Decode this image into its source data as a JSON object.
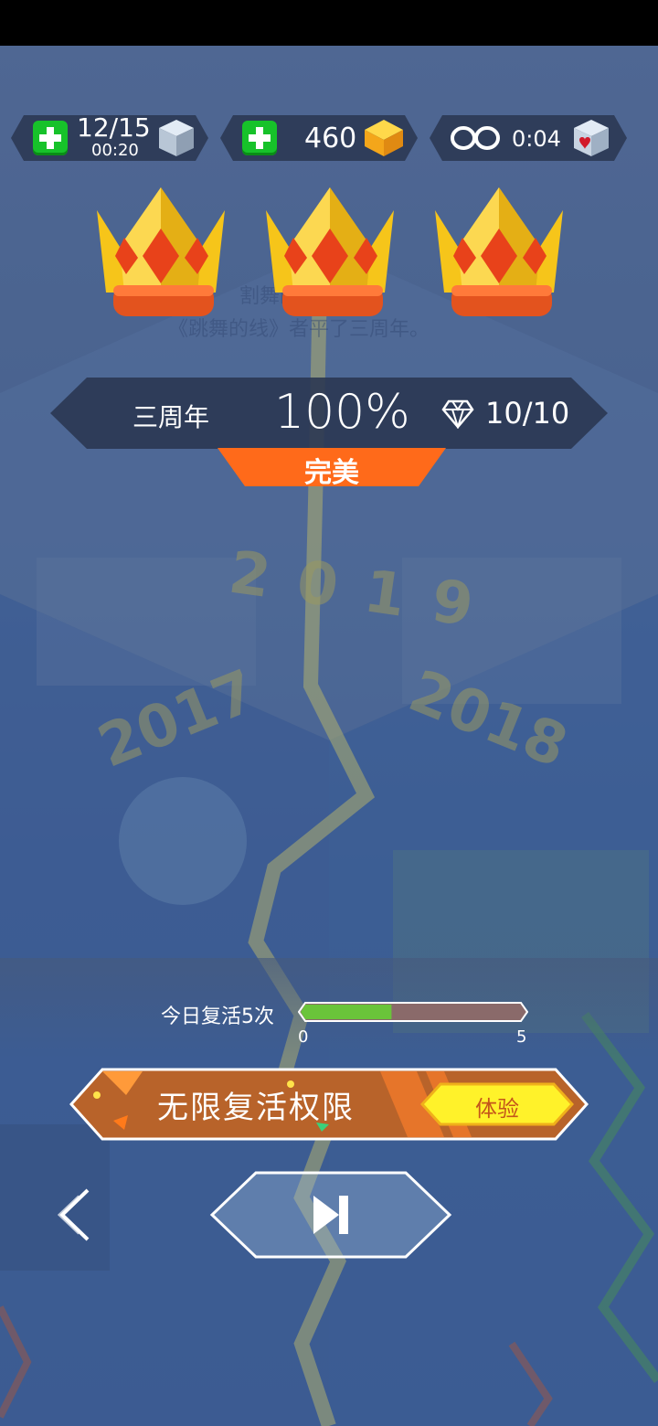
{
  "hud": {
    "lives": {
      "value": "12/15",
      "timer": "00:20"
    },
    "gems": {
      "value": "460"
    },
    "infinite": {
      "timer": "0:04"
    }
  },
  "result": {
    "crowns": 3,
    "level_name": "三周年",
    "percent": "100%",
    "diamonds": "10/10",
    "rating": "完美"
  },
  "background_text": {
    "line1": "割舞的坐世,",
    "line2": "《跳舞的线》者平了三周年。",
    "year_2019": "2019",
    "year_2017": "2017",
    "year_2018": "2018"
  },
  "revive": {
    "label": "今日复活5次",
    "min": "0",
    "max": "5",
    "progress": 0.4
  },
  "unlimited": {
    "title": "无限复活权限",
    "try_label": "体验"
  },
  "colors": {
    "accent_orange": "#ff6a1a",
    "crown_gold": "#f6c51a",
    "progress_green": "#6ac43a",
    "try_yellow": "#fff22a"
  },
  "icons": [
    "plus-icon",
    "ice-cube-icon",
    "gem-icon",
    "infinity-icon",
    "heart-cube-icon",
    "crown-icon",
    "diamond-outline-icon",
    "back-chevron-icon",
    "next-skip-icon"
  ]
}
